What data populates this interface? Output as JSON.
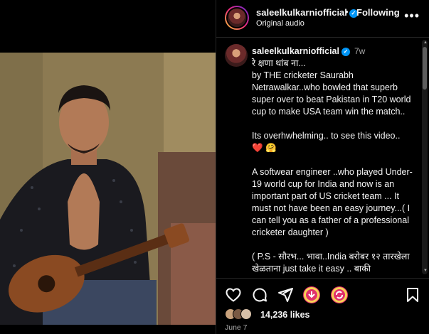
{
  "header": {
    "username": "saleelkulkarniofficial",
    "separator": "•",
    "follow_state": "Following",
    "audio": "Original audio",
    "more": "•••"
  },
  "caption": {
    "username": "saleelkulkarniofficial",
    "time_ago": "7w",
    "paragraphs": [
      "रे क्षणा थांब ना...",
      "by THE cricketer Saurabh Netrawalkar..who bowled that superb super over to beat Pakistan in T20 world cup to make USA team win the match..",
      "Its overhwhelming.. to see this video..",
      "A softwear engineer ..who played Under-19 world cup for India and now is an important part of US cricket team ... It must not have been an easy journey...( I can tell you as a father of a professional cricketer daughter )",
      "( P.S - सौरभ... भावा..India बरोबर १२ तारखेला खेळताना just take it easy .. बाकी"
    ],
    "emoji": "❤️ 🤗"
  },
  "actions": {
    "likes": "14,236 likes",
    "date": "June 7"
  },
  "colors": {
    "verified": "#0095f6",
    "text": "#f5f5f5",
    "muted": "#a8a8a8",
    "divider": "#262626"
  },
  "icons": [
    "verified-icon",
    "more-icon",
    "heart-icon",
    "comment-icon",
    "share-icon",
    "bookmark-icon"
  ]
}
